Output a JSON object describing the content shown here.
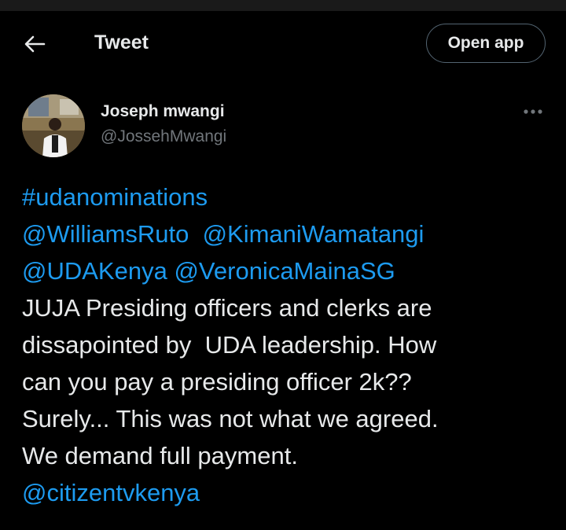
{
  "header": {
    "title": "Tweet",
    "open_app_label": "Open app"
  },
  "author": {
    "name": "Joseph mwangi",
    "handle": "@JossehMwangi"
  },
  "tweet": {
    "hashtag": "#udanominations",
    "mention_1": "@WilliamsRuto",
    "mention_2": "@KimaniWamatangi",
    "mention_3": "@UDAKenya",
    "mention_4": "@VeronicaMainaSG",
    "line_1": "JUJA Presiding officers and clerks are",
    "line_2": "dissapointed by  UDA leadership. How",
    "line_3": "can you pay a presiding officer 2k??",
    "line_4": "Surely... This was not what we agreed.",
    "line_5": "We demand full payment.",
    "mention_5": "@citizentvkenya"
  },
  "colors": {
    "background": "#000000",
    "link": "#1d9bf0",
    "text": "#e7e9ea",
    "secondary": "#71767b"
  },
  "icons": {
    "back": "arrow-left-icon",
    "more": "more-horizontal-icon"
  }
}
